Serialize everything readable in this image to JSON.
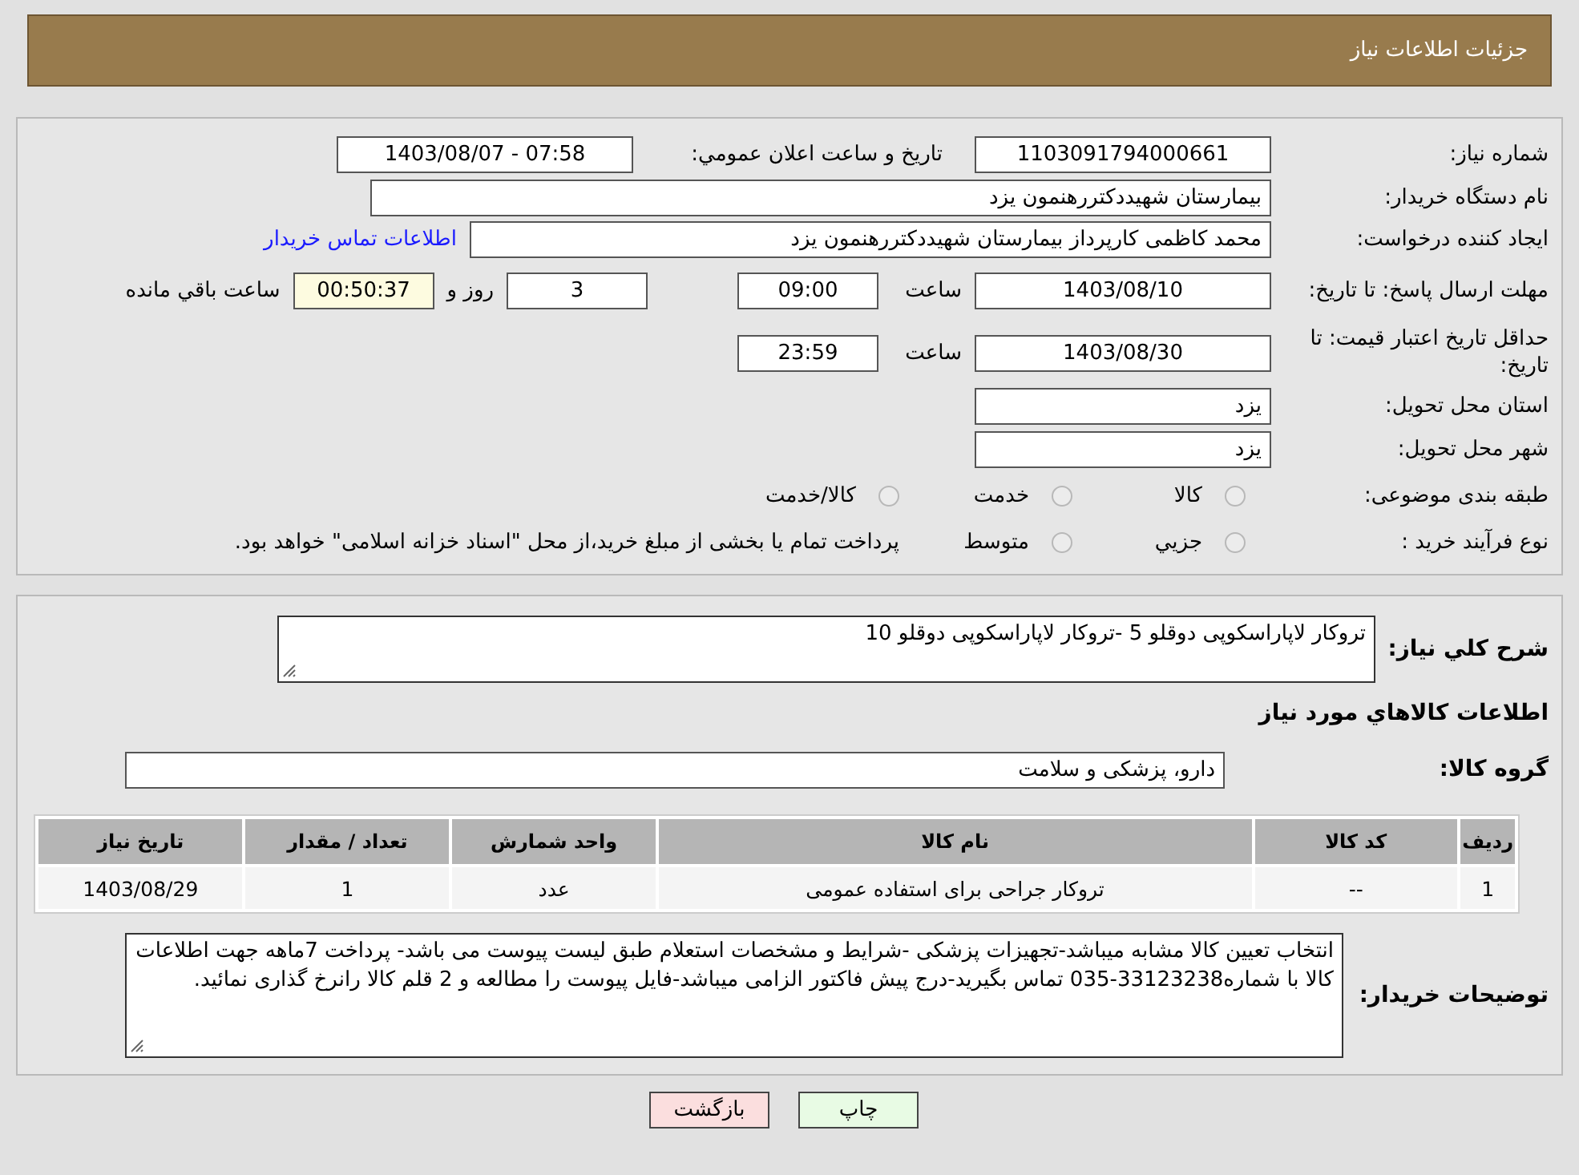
{
  "header": {
    "title": "جزئیات اطلاعات نیاز"
  },
  "need_number": {
    "label": "شماره نیاز:",
    "value": "1103091794000661"
  },
  "announce": {
    "label": "تاریخ و ساعت اعلان عمومي:",
    "value": "1403/08/07 - 07:58"
  },
  "buyer_org": {
    "label": "نام دستگاه خریدار:",
    "value": "بیمارستان شهیددکتررهنمون یزد"
  },
  "requester": {
    "label": "ایجاد کننده درخواست:",
    "value": "محمد کاظمی کارپرداز بیمارستان شهیددکتررهنمون یزد",
    "link": "اطلاعات تماس خریدار"
  },
  "reply_deadline": {
    "label": "مهلت ارسال پاسخ: تا تاریخ:",
    "date": "1403/08/10",
    "time_label": "ساعت",
    "time": "09:00",
    "days": "3",
    "days_label": "روز و",
    "remaining": "00:50:37",
    "remaining_label": "ساعت باقي مانده"
  },
  "price_validity": {
    "label": "حداقل تاریخ اعتبار قیمت: تا تاریخ:",
    "date": "1403/08/30",
    "time_label": "ساعت",
    "time": "23:59"
  },
  "province": {
    "label": "استان محل تحویل:",
    "value": "یزد"
  },
  "city": {
    "label": "شهر محل تحویل:",
    "value": "یزد"
  },
  "category": {
    "label": "طبقه بندی موضوعی:",
    "options": [
      {
        "label": "کالا",
        "selected": false
      },
      {
        "label": "خدمت",
        "selected": false
      },
      {
        "label": "کالا/خدمت",
        "selected": false
      }
    ]
  },
  "process": {
    "label": "نوع فرآیند خرید :",
    "options": [
      {
        "label": "جزيي",
        "selected": false
      },
      {
        "label": "متوسط",
        "selected": false
      }
    ],
    "note": "پرداخت تمام یا بخشی از مبلغ خرید،از محل \"اسناد خزانه اسلامی\" خواهد بود."
  },
  "description": {
    "label": "شرح کلي نیاز:",
    "value": "تروکار لاپاراسکوپی دوقلو 5 -تروکار لاپاراسکوپی دوقلو 10"
  },
  "items_heading": "اطلاعات کالاهاي مورد نیاز",
  "goods_group": {
    "label": "گروه کالا:",
    "value": "دارو، پزشکی و سلامت"
  },
  "table": {
    "columns": [
      "ردیف",
      "کد کالا",
      "نام کالا",
      "واحد شمارش",
      "تعداد / مقدار",
      "تاریخ نیاز"
    ],
    "rows": [
      [
        "1",
        "--",
        "تروکار جراحی برای استفاده عمومی",
        "عدد",
        "1",
        "1403/08/29"
      ]
    ]
  },
  "buyer_notes": {
    "label": "توضیحات خریدار:",
    "value": "انتخاب تعیین کالا مشابه میباشد-تجهیزات پزشکی -شرایط و مشخصات استعلام طبق لیست پیوست می باشد- پرداخت 7ماهه جهت اطلاعات کالا با شماره33123238-035 تماس بگیرید-درج پیش فاکتور الزامی میباشد-فایل پیوست را مطالعه و 2 قلم کالا رانرخ گذاری نمائید."
  },
  "buttons": [
    {
      "label": "چاپ",
      "kind": "print"
    },
    {
      "label": "بازگشت",
      "kind": "back"
    }
  ]
}
